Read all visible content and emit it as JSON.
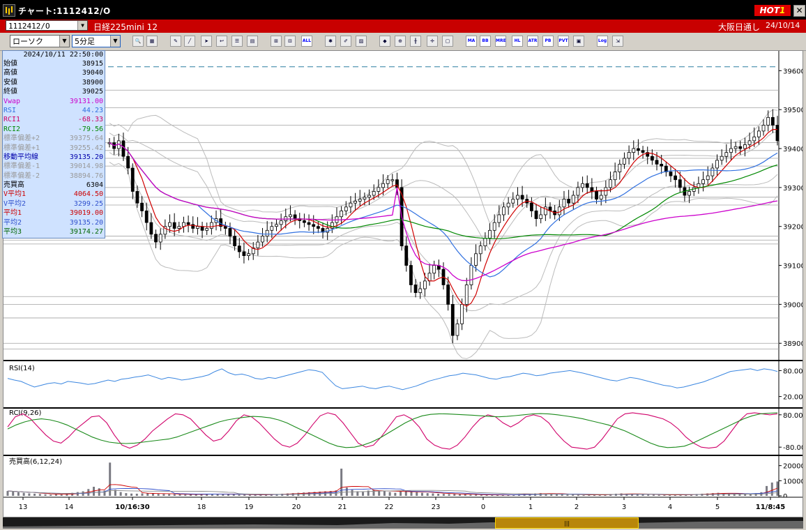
{
  "window": {
    "title": "チャート:1112412/O",
    "hot_label": "HOT",
    "hot_num": "1",
    "close": "✕"
  },
  "symbol_bar": {
    "code": "1112412/O",
    "name": "日経225mini 12",
    "market": "大阪日通し",
    "date": "24/10/14"
  },
  "toolbar": {
    "chart_type": "ローソク",
    "interval": "5分足",
    "buttons": [
      {
        "name": "search-button",
        "glyph": "🔍"
      },
      {
        "name": "layout-button",
        "glyph": "▦"
      },
      {
        "name": "draw-button",
        "glyph": "✎"
      },
      {
        "name": "line-button",
        "glyph": "╱"
      },
      {
        "name": "cursor-button",
        "glyph": "➤"
      },
      {
        "name": "arrow-button",
        "glyph": "↩"
      },
      {
        "name": "list-button",
        "glyph": "☰"
      },
      {
        "name": "save-button",
        "glyph": "▤"
      },
      {
        "name": "candle-button",
        "glyph": "⊞"
      },
      {
        "name": "bar-button",
        "glyph": "⊟"
      },
      {
        "name": "all-button",
        "glyph": "ALL",
        "text": true
      },
      {
        "name": "settings-button",
        "glyph": "✱"
      },
      {
        "name": "tool-button",
        "glyph": "✐"
      },
      {
        "name": "color-button",
        "glyph": "▨"
      },
      {
        "name": "alert-button",
        "glyph": "◆"
      },
      {
        "name": "zoom-button",
        "glyph": "⊕"
      },
      {
        "name": "ind1-button",
        "glyph": "╫"
      },
      {
        "name": "ind2-button",
        "glyph": "✛"
      },
      {
        "name": "ind3-button",
        "glyph": "▢"
      },
      {
        "name": "ma-button",
        "glyph": "MA",
        "text": true
      },
      {
        "name": "bb-button",
        "glyph": "BB",
        "text": true
      },
      {
        "name": "mre-button",
        "glyph": "MRE",
        "text": true
      },
      {
        "name": "hl-button",
        "glyph": "HL",
        "text": true
      },
      {
        "name": "atr-button",
        "glyph": "ATR",
        "text": true
      },
      {
        "name": "pb-button",
        "glyph": "PB",
        "text": true
      },
      {
        "name": "pvt-button",
        "glyph": "PVT",
        "text": true
      },
      {
        "name": "frame-button",
        "glyph": "▣"
      },
      {
        "name": "log-button",
        "glyph": "Log",
        "text": true
      },
      {
        "name": "export-button",
        "glyph": "⇲"
      }
    ]
  },
  "info_panel": {
    "timestamp": "2024/10/11 22:50:00",
    "rows": [
      {
        "label": "始値",
        "value": "38915",
        "color": "#000000"
      },
      {
        "label": "高値",
        "value": "39040",
        "color": "#000000"
      },
      {
        "label": "安値",
        "value": "38900",
        "color": "#000000"
      },
      {
        "label": "終値",
        "value": "39025",
        "color": "#000000"
      },
      {
        "label": "Vwap",
        "value": "39131.00",
        "color": "#cc00cc"
      },
      {
        "label": "RSI",
        "value": "44.23",
        "color": "#3070e0"
      },
      {
        "label": "RCI1",
        "value": "-68.33",
        "color": "#cc0066"
      },
      {
        "label": "RCI2",
        "value": "-79.56",
        "color": "#008800"
      },
      {
        "label": "標準偏差+2",
        "value": "39375.64",
        "color": "#999999"
      },
      {
        "label": "標準偏差+1",
        "value": "39255.42",
        "color": "#999999"
      },
      {
        "label": "移動平均線",
        "value": "39135.20",
        "color": "#0000aa"
      },
      {
        "label": "標準偏差-1",
        "value": "39014.98",
        "color": "#999999"
      },
      {
        "label": "標準偏差-2",
        "value": "38894.76",
        "color": "#999999"
      },
      {
        "label": "売買高",
        "value": "6304",
        "color": "#000000"
      },
      {
        "label": "V平均1",
        "value": "4064.50",
        "color": "#cc0000"
      },
      {
        "label": "V平均2",
        "value": "3299.25",
        "color": "#3050cc"
      },
      {
        "label": "平均1",
        "value": "39019.00",
        "color": "#cc0000"
      },
      {
        "label": "平均2",
        "value": "39135.20",
        "color": "#3050cc"
      },
      {
        "label": "平均3",
        "value": "39174.27",
        "color": "#006600"
      }
    ]
  },
  "chart_data": [
    {
      "type": "line",
      "title": "",
      "price_axis": {
        "min": 38870,
        "max": 39640,
        "ticks": [
          "39600",
          "39500",
          "39400",
          "39300",
          "39200",
          "39100",
          "39000",
          "38900"
        ]
      },
      "x_labels": [
        "13",
        "14",
        "10/16:30",
        "18",
        "19",
        "20",
        "21",
        "22",
        "23",
        "0",
        "1",
        "2",
        "3",
        "4",
        "5",
        "11/8:45"
      ],
      "dashed_level": 39610,
      "h_levels": [
        39550,
        39505,
        39460,
        39415,
        39395,
        39375,
        39355,
        39300,
        39275,
        39255,
        39175,
        39165,
        39155,
        39020,
        39000,
        38965,
        38900,
        38885
      ],
      "close_path": [
        39415,
        39400,
        39420,
        39380,
        39350,
        39290,
        39260,
        39240,
        39210,
        39180,
        39160,
        39180,
        39200,
        39210,
        39195,
        39200,
        39210,
        39205,
        39195,
        39200,
        39190,
        39195,
        39210,
        39220,
        39200,
        39195,
        39175,
        39150,
        39135,
        39125,
        39130,
        39145,
        39160,
        39175,
        39190,
        39200,
        39205,
        39215,
        39225,
        39230,
        39220,
        39215,
        39210,
        39205,
        39200,
        39195,
        39185,
        39195,
        39210,
        39225,
        39240,
        39250,
        39260,
        39265,
        39270,
        39275,
        39280,
        39290,
        39300,
        39310,
        39320,
        39320,
        39300,
        39150,
        39100,
        39050,
        39030,
        39040,
        39060,
        39080,
        39100,
        39090,
        39050,
        39000,
        38920,
        38950,
        39000,
        39050,
        39100,
        39130,
        39150,
        39170,
        39190,
        39210,
        39230,
        39250,
        39260,
        39270,
        39280,
        39270,
        39260,
        39240,
        39220,
        39230,
        39250,
        39240,
        39230,
        39250,
        39270,
        39260,
        39280,
        39300,
        39310,
        39300,
        39290,
        39270,
        39280,
        39300,
        39320,
        39340,
        39360,
        39375,
        39390,
        39400,
        39395,
        39390,
        39380,
        39370,
        39360,
        39355,
        39340,
        39330,
        39320,
        39300,
        39280,
        39290,
        39300,
        39310,
        39320,
        39330,
        39350,
        39370,
        39380,
        39390,
        39400,
        39405,
        39400,
        39410,
        39420,
        39430,
        39445,
        39460,
        39480,
        39460,
        39420
      ],
      "series": [
        {
          "name": "平均1",
          "color": "#d00000"
        },
        {
          "name": "平均2",
          "color": "#3070e0"
        },
        {
          "name": "平均3",
          "color": "#008800"
        },
        {
          "name": "Vwap",
          "color": "#cc00cc"
        }
      ]
    },
    {
      "type": "line",
      "title": "RSI(14)",
      "ylim": [
        0,
        100
      ],
      "ticks": [
        "80.00",
        "20.00"
      ],
      "values": [
        62,
        58,
        55,
        48,
        42,
        46,
        50,
        52,
        49,
        55,
        53,
        51,
        48,
        50,
        54,
        58,
        55,
        60,
        62,
        65,
        67,
        70,
        65,
        60,
        64,
        62,
        58,
        60,
        63,
        66,
        70,
        78,
        84,
        75,
        70,
        72,
        68,
        62,
        60,
        64,
        62,
        66,
        70,
        74,
        78,
        82,
        80,
        76,
        60,
        45,
        38,
        40,
        42,
        44,
        40,
        38,
        42,
        44,
        40,
        36,
        40,
        44,
        50,
        56,
        60,
        64,
        68,
        70,
        74,
        72,
        70,
        66,
        62,
        60,
        64,
        66,
        70,
        74,
        72,
        68,
        70,
        74,
        76,
        78,
        80,
        77,
        74,
        70,
        66,
        62,
        58,
        56,
        60,
        64,
        62,
        58,
        54,
        50,
        46,
        44,
        40,
        42,
        46,
        50,
        54,
        60,
        66,
        72,
        78,
        80,
        82,
        84,
        80,
        84,
        82,
        78
      ]
    },
    {
      "type": "line",
      "title": "RCI(9,26)",
      "ylim": [
        -100,
        100
      ],
      "ticks": [
        "80.00",
        "-80.00"
      ],
      "series": [
        {
          "name": "RCI1",
          "color": "#d0006a",
          "values": [
            20,
            70,
            85,
            60,
            20,
            -20,
            -50,
            -60,
            -30,
            10,
            40,
            70,
            75,
            40,
            -20,
            -70,
            -85,
            -70,
            -40,
            0,
            30,
            60,
            85,
            80,
            60,
            20,
            -20,
            -50,
            -40,
            0,
            50,
            80,
            70,
            40,
            0,
            -40,
            -70,
            -80,
            -60,
            -20,
            30,
            75,
            90,
            80,
            40,
            -10,
            -60,
            -80,
            -70,
            -30,
            20,
            70,
            80,
            60,
            20,
            -40,
            -70,
            -85,
            -90,
            -70,
            -30,
            20,
            60,
            80,
            70,
            40,
            20,
            40,
            70,
            80,
            70,
            40,
            -10,
            -50,
            -80,
            -85,
            -90,
            -80,
            -40,
            10,
            60,
            85,
            90,
            85,
            80,
            70,
            60,
            40,
            10,
            -30,
            -60,
            -80,
            -85,
            -80,
            -50,
            0,
            50,
            85,
            90,
            85,
            80,
            85
          ]
        },
        {
          "name": "RCI2",
          "color": "#1a8a1a",
          "values": [
            10,
            30,
            45,
            55,
            60,
            55,
            45,
            30,
            10,
            -10,
            -30,
            -45,
            -55,
            -60,
            -62,
            -60,
            -55,
            -50,
            -45,
            -40,
            -30,
            -15,
            0,
            15,
            30,
            45,
            55,
            62,
            68,
            72,
            70,
            65,
            55,
            40,
            20,
            0,
            -20,
            -40,
            -60,
            -75,
            -82,
            -80,
            -70,
            -55,
            -35,
            -10,
            15,
            40,
            60,
            75,
            82,
            85,
            84,
            82,
            80,
            78,
            75,
            72,
            70,
            72,
            76,
            80,
            84,
            86,
            84,
            80,
            74,
            68,
            60,
            50,
            40,
            30,
            15,
            0,
            -20,
            -40,
            -60,
            -75,
            -82,
            -80,
            -75,
            -60,
            -40,
            -20,
            0,
            20,
            40,
            60,
            75,
            85,
            88,
            90
          ]
        }
      ]
    },
    {
      "type": "bar",
      "title": "売買高(6,12,24)",
      "ylim": [
        0,
        24000
      ],
      "ticks": [
        "20000",
        "10000",
        "0"
      ],
      "values": [
        3200,
        2800,
        2400,
        2000,
        1600,
        1400,
        1200,
        1000,
        800,
        900,
        1100,
        1500,
        2000,
        2500,
        3000,
        4500,
        6000,
        5000,
        3500,
        22000,
        4000,
        2500,
        1800,
        1500,
        1400,
        1600,
        1800,
        1500,
        1300,
        1200,
        1100,
        1000,
        900,
        800,
        900,
        1000,
        1200,
        1400,
        1300,
        1200,
        1100,
        1000,
        900,
        800,
        700,
        600,
        700,
        800,
        900,
        1000,
        1200,
        1400,
        1600,
        1800,
        2000,
        2200,
        2400,
        2600,
        2800,
        3000,
        3200,
        3600,
        18000,
        5500,
        4000,
        3000,
        2500,
        3500,
        4000,
        3500,
        3000,
        2500,
        2000,
        2800,
        3400,
        3000,
        2400,
        2000,
        1800,
        1600,
        1400,
        1300,
        1200,
        1100,
        1000,
        900,
        800,
        700,
        600,
        500,
        500,
        600,
        700,
        800,
        900,
        1000,
        1200,
        1400,
        1600,
        1800,
        1500,
        1300,
        1100,
        900,
        800,
        700,
        600,
        500,
        600,
        700,
        800,
        1000,
        1200,
        1400,
        1600,
        1400,
        1200,
        1000,
        900,
        800,
        700,
        600,
        500,
        600,
        700,
        800,
        900,
        1000,
        1200,
        1400,
        1600,
        1800,
        2000,
        1800,
        1600,
        1400,
        1200,
        1000,
        1400,
        1800,
        2400,
        6500,
        8800,
        9500
      ]
    }
  ]
}
